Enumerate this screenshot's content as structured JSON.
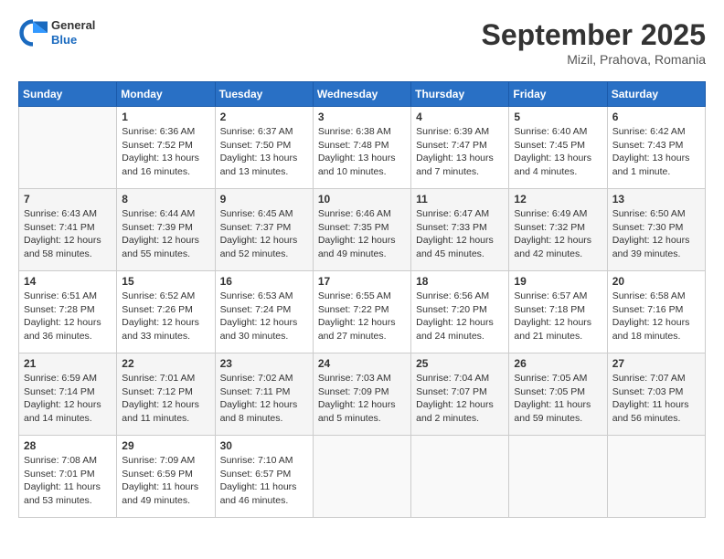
{
  "header": {
    "logo": {
      "general": "General",
      "blue": "Blue"
    },
    "title": "September 2025",
    "subtitle": "Mizil, Prahova, Romania"
  },
  "days_of_week": [
    "Sunday",
    "Monday",
    "Tuesday",
    "Wednesday",
    "Thursday",
    "Friday",
    "Saturday"
  ],
  "weeks": [
    [
      {
        "day": "",
        "sunrise": "",
        "sunset": "",
        "daylight": ""
      },
      {
        "day": "1",
        "sunrise": "Sunrise: 6:36 AM",
        "sunset": "Sunset: 7:52 PM",
        "daylight": "Daylight: 13 hours and 16 minutes."
      },
      {
        "day": "2",
        "sunrise": "Sunrise: 6:37 AM",
        "sunset": "Sunset: 7:50 PM",
        "daylight": "Daylight: 13 hours and 13 minutes."
      },
      {
        "day": "3",
        "sunrise": "Sunrise: 6:38 AM",
        "sunset": "Sunset: 7:48 PM",
        "daylight": "Daylight: 13 hours and 10 minutes."
      },
      {
        "day": "4",
        "sunrise": "Sunrise: 6:39 AM",
        "sunset": "Sunset: 7:47 PM",
        "daylight": "Daylight: 13 hours and 7 minutes."
      },
      {
        "day": "5",
        "sunrise": "Sunrise: 6:40 AM",
        "sunset": "Sunset: 7:45 PM",
        "daylight": "Daylight: 13 hours and 4 minutes."
      },
      {
        "day": "6",
        "sunrise": "Sunrise: 6:42 AM",
        "sunset": "Sunset: 7:43 PM",
        "daylight": "Daylight: 13 hours and 1 minute."
      }
    ],
    [
      {
        "day": "7",
        "sunrise": "Sunrise: 6:43 AM",
        "sunset": "Sunset: 7:41 PM",
        "daylight": "Daylight: 12 hours and 58 minutes."
      },
      {
        "day": "8",
        "sunrise": "Sunrise: 6:44 AM",
        "sunset": "Sunset: 7:39 PM",
        "daylight": "Daylight: 12 hours and 55 minutes."
      },
      {
        "day": "9",
        "sunrise": "Sunrise: 6:45 AM",
        "sunset": "Sunset: 7:37 PM",
        "daylight": "Daylight: 12 hours and 52 minutes."
      },
      {
        "day": "10",
        "sunrise": "Sunrise: 6:46 AM",
        "sunset": "Sunset: 7:35 PM",
        "daylight": "Daylight: 12 hours and 49 minutes."
      },
      {
        "day": "11",
        "sunrise": "Sunrise: 6:47 AM",
        "sunset": "Sunset: 7:33 PM",
        "daylight": "Daylight: 12 hours and 45 minutes."
      },
      {
        "day": "12",
        "sunrise": "Sunrise: 6:49 AM",
        "sunset": "Sunset: 7:32 PM",
        "daylight": "Daylight: 12 hours and 42 minutes."
      },
      {
        "day": "13",
        "sunrise": "Sunrise: 6:50 AM",
        "sunset": "Sunset: 7:30 PM",
        "daylight": "Daylight: 12 hours and 39 minutes."
      }
    ],
    [
      {
        "day": "14",
        "sunrise": "Sunrise: 6:51 AM",
        "sunset": "Sunset: 7:28 PM",
        "daylight": "Daylight: 12 hours and 36 minutes."
      },
      {
        "day": "15",
        "sunrise": "Sunrise: 6:52 AM",
        "sunset": "Sunset: 7:26 PM",
        "daylight": "Daylight: 12 hours and 33 minutes."
      },
      {
        "day": "16",
        "sunrise": "Sunrise: 6:53 AM",
        "sunset": "Sunset: 7:24 PM",
        "daylight": "Daylight: 12 hours and 30 minutes."
      },
      {
        "day": "17",
        "sunrise": "Sunrise: 6:55 AM",
        "sunset": "Sunset: 7:22 PM",
        "daylight": "Daylight: 12 hours and 27 minutes."
      },
      {
        "day": "18",
        "sunrise": "Sunrise: 6:56 AM",
        "sunset": "Sunset: 7:20 PM",
        "daylight": "Daylight: 12 hours and 24 minutes."
      },
      {
        "day": "19",
        "sunrise": "Sunrise: 6:57 AM",
        "sunset": "Sunset: 7:18 PM",
        "daylight": "Daylight: 12 hours and 21 minutes."
      },
      {
        "day": "20",
        "sunrise": "Sunrise: 6:58 AM",
        "sunset": "Sunset: 7:16 PM",
        "daylight": "Daylight: 12 hours and 18 minutes."
      }
    ],
    [
      {
        "day": "21",
        "sunrise": "Sunrise: 6:59 AM",
        "sunset": "Sunset: 7:14 PM",
        "daylight": "Daylight: 12 hours and 14 minutes."
      },
      {
        "day": "22",
        "sunrise": "Sunrise: 7:01 AM",
        "sunset": "Sunset: 7:12 PM",
        "daylight": "Daylight: 12 hours and 11 minutes."
      },
      {
        "day": "23",
        "sunrise": "Sunrise: 7:02 AM",
        "sunset": "Sunset: 7:11 PM",
        "daylight": "Daylight: 12 hours and 8 minutes."
      },
      {
        "day": "24",
        "sunrise": "Sunrise: 7:03 AM",
        "sunset": "Sunset: 7:09 PM",
        "daylight": "Daylight: 12 hours and 5 minutes."
      },
      {
        "day": "25",
        "sunrise": "Sunrise: 7:04 AM",
        "sunset": "Sunset: 7:07 PM",
        "daylight": "Daylight: 12 hours and 2 minutes."
      },
      {
        "day": "26",
        "sunrise": "Sunrise: 7:05 AM",
        "sunset": "Sunset: 7:05 PM",
        "daylight": "Daylight: 11 hours and 59 minutes."
      },
      {
        "day": "27",
        "sunrise": "Sunrise: 7:07 AM",
        "sunset": "Sunset: 7:03 PM",
        "daylight": "Daylight: 11 hours and 56 minutes."
      }
    ],
    [
      {
        "day": "28",
        "sunrise": "Sunrise: 7:08 AM",
        "sunset": "Sunset: 7:01 PM",
        "daylight": "Daylight: 11 hours and 53 minutes."
      },
      {
        "day": "29",
        "sunrise": "Sunrise: 7:09 AM",
        "sunset": "Sunset: 6:59 PM",
        "daylight": "Daylight: 11 hours and 49 minutes."
      },
      {
        "day": "30",
        "sunrise": "Sunrise: 7:10 AM",
        "sunset": "Sunset: 6:57 PM",
        "daylight": "Daylight: 11 hours and 46 minutes."
      },
      {
        "day": "",
        "sunrise": "",
        "sunset": "",
        "daylight": ""
      },
      {
        "day": "",
        "sunrise": "",
        "sunset": "",
        "daylight": ""
      },
      {
        "day": "",
        "sunrise": "",
        "sunset": "",
        "daylight": ""
      },
      {
        "day": "",
        "sunrise": "",
        "sunset": "",
        "daylight": ""
      }
    ]
  ]
}
